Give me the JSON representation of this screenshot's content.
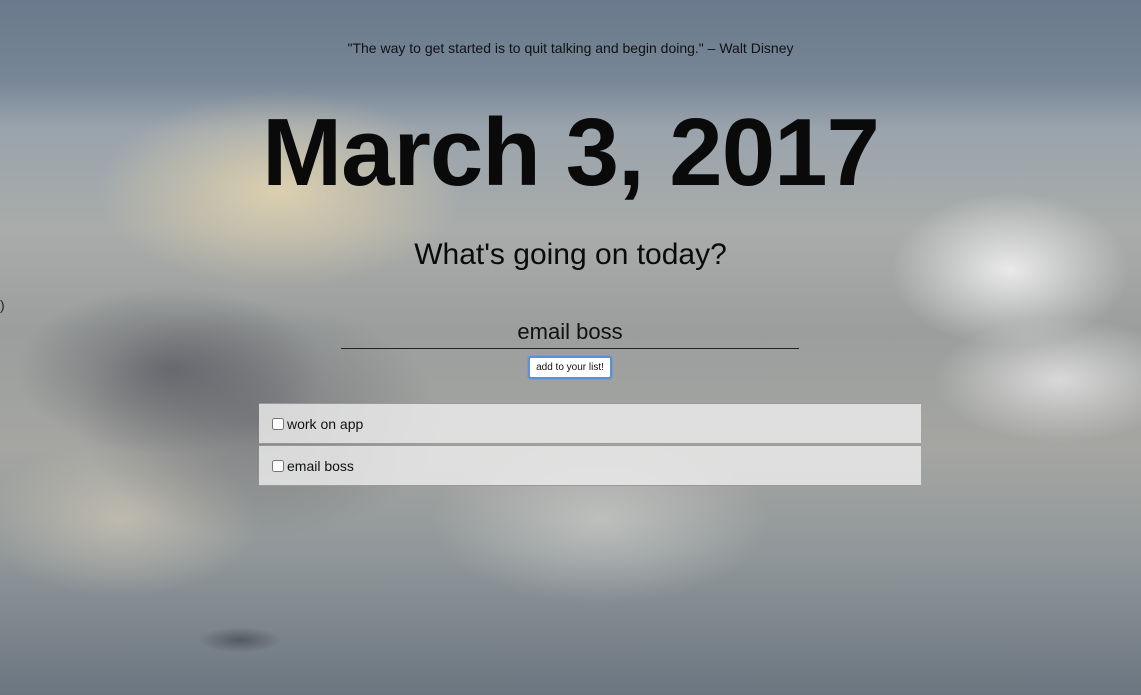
{
  "quote": "\"The way to get started is to quit talking and begin doing.\" – Walt Disney",
  "date": "March 3, 2017",
  "prompt": "What's going on today?",
  "input": {
    "value": "email boss",
    "placeholder": ""
  },
  "add_button_label": "add to your list!",
  "todos": [
    {
      "label": "work on app",
      "checked": false
    },
    {
      "label": "email boss",
      "checked": false
    }
  ],
  "edge_glyph": ")",
  "colors": {
    "button_focus": "#5b8fd6",
    "list_item_bg": "#ececec"
  }
}
